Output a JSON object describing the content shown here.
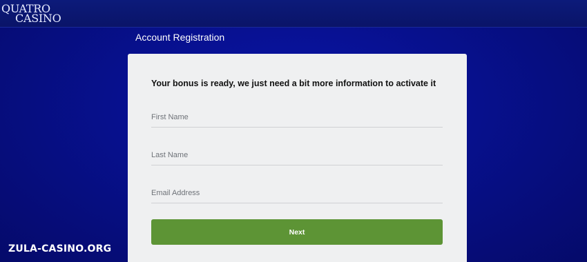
{
  "header": {
    "logo_line1": "QUATRO",
    "logo_line2": "CASINO"
  },
  "page": {
    "title": "Account Registration"
  },
  "form": {
    "headline": "Your bonus is ready, we just need a bit more information to activate it",
    "first_name": {
      "placeholder": "First Name",
      "value": ""
    },
    "last_name": {
      "placeholder": "Last Name",
      "value": ""
    },
    "email": {
      "placeholder": "Email Address",
      "value": ""
    },
    "next_label": "Next",
    "button_color": "#5d9435"
  },
  "watermark": "ZULA-CASINO.ORG"
}
